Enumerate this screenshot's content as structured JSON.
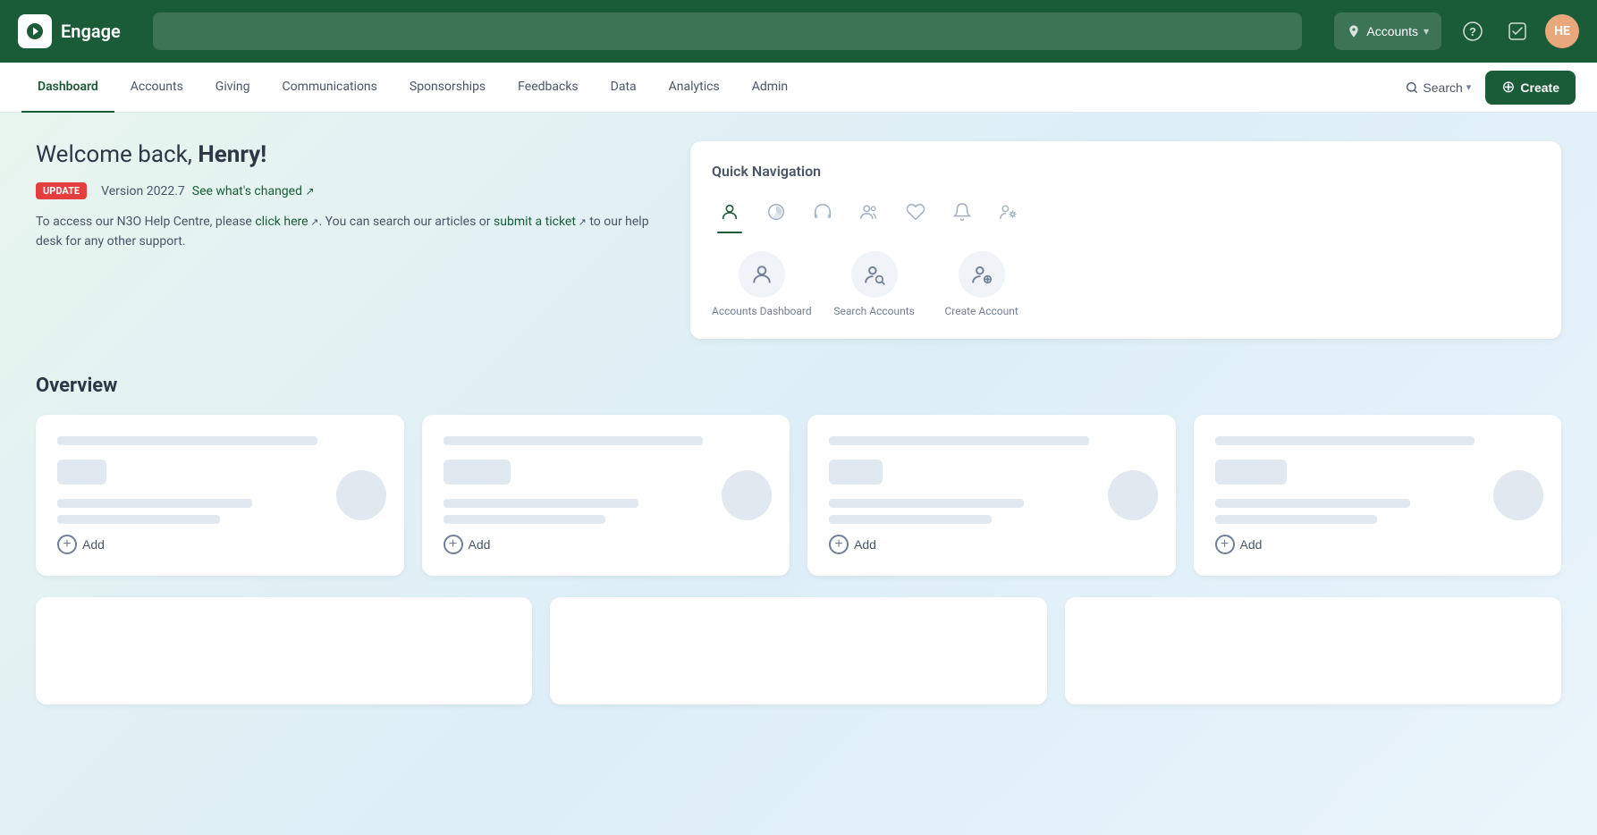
{
  "app": {
    "name": "Engage",
    "logo_alt": "Engage logo"
  },
  "top_nav": {
    "search_placeholder": "",
    "search_scope": "Accounts",
    "help_label": "?",
    "checklist_label": "✓",
    "avatar_initials": "HE"
  },
  "sec_nav": {
    "items": [
      {
        "id": "dashboard",
        "label": "Dashboard",
        "active": true
      },
      {
        "id": "accounts",
        "label": "Accounts",
        "active": false
      },
      {
        "id": "giving",
        "label": "Giving",
        "active": false
      },
      {
        "id": "communications",
        "label": "Communications",
        "active": false
      },
      {
        "id": "sponsorships",
        "label": "Sponsorships",
        "active": false
      },
      {
        "id": "feedbacks",
        "label": "Feedbacks",
        "active": false
      },
      {
        "id": "data",
        "label": "Data",
        "active": false
      },
      {
        "id": "analytics",
        "label": "Analytics",
        "active": false
      },
      {
        "id": "admin",
        "label": "Admin",
        "active": false
      }
    ],
    "search_label": "Search",
    "create_label": "Create"
  },
  "welcome": {
    "greeting": "Welcome back, ",
    "username": "Henry!",
    "update_badge": "UPDATE",
    "version": "Version 2022.7",
    "see_whats_changed": "See what's changed",
    "help_text_before": "To access our N3O Help Centre, please ",
    "click_here": "click here",
    "help_text_mid": ". You can search our articles or ",
    "submit_ticket": "submit a ticket",
    "help_text_after": " to our help desk for any other support."
  },
  "quick_nav": {
    "title": "Quick Navigation",
    "icons": [
      {
        "id": "person",
        "symbol": "👤",
        "active": true
      },
      {
        "id": "chart",
        "symbol": "📊",
        "active": false
      },
      {
        "id": "headset",
        "symbol": "🎧",
        "active": false
      },
      {
        "id": "group",
        "symbol": "👥",
        "active": false
      },
      {
        "id": "heart",
        "symbol": "♡",
        "active": false
      },
      {
        "id": "bell",
        "symbol": "🔔",
        "active": false
      },
      {
        "id": "people-settings",
        "symbol": "👤⚙",
        "active": false
      }
    ],
    "shortcuts": [
      {
        "id": "accounts-dashboard",
        "label": "Accounts Dashboard",
        "icon": "person"
      },
      {
        "id": "search-accounts",
        "label": "Search Accounts",
        "icon": "search-person"
      },
      {
        "id": "create-account",
        "label": "Create Account",
        "icon": "create-person"
      }
    ]
  },
  "overview": {
    "title": "Overview",
    "cards": [
      {
        "id": "card1",
        "add_label": "Add"
      },
      {
        "id": "card2",
        "add_label": "Add"
      },
      {
        "id": "card3",
        "add_label": "Add"
      },
      {
        "id": "card4",
        "add_label": "Add"
      }
    ],
    "wide_cards": [
      {
        "id": "wide1"
      },
      {
        "id": "wide2"
      },
      {
        "id": "wide3"
      }
    ]
  }
}
